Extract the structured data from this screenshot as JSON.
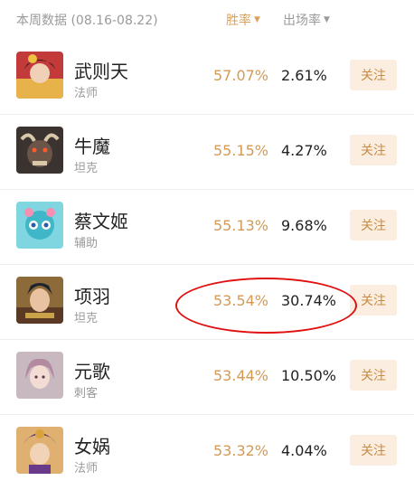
{
  "header": {
    "title": "本周数据 (08.16-08.22)",
    "win_rate_sort": "胜率",
    "pick_rate_sort": "出场率",
    "sort_arrow": "▼"
  },
  "follow_label": "关注",
  "heroes": [
    {
      "name": "武则天",
      "role": "法师",
      "win_rate": "57.07%",
      "pick_rate": "2.61%"
    },
    {
      "name": "牛魔",
      "role": "坦克",
      "win_rate": "55.15%",
      "pick_rate": "4.27%"
    },
    {
      "name": "蔡文姬",
      "role": "辅助",
      "win_rate": "55.13%",
      "pick_rate": "9.68%"
    },
    {
      "name": "项羽",
      "role": "坦克",
      "win_rate": "53.54%",
      "pick_rate": "30.74%"
    },
    {
      "name": "元歌",
      "role": "刺客",
      "win_rate": "53.44%",
      "pick_rate": "10.50%"
    },
    {
      "name": "女娲",
      "role": "法师",
      "win_rate": "53.32%",
      "pick_rate": "4.04%"
    }
  ],
  "colors": {
    "accent": "#d49a54",
    "follow_bg": "#fbeee0",
    "annotation": "#e01010"
  }
}
